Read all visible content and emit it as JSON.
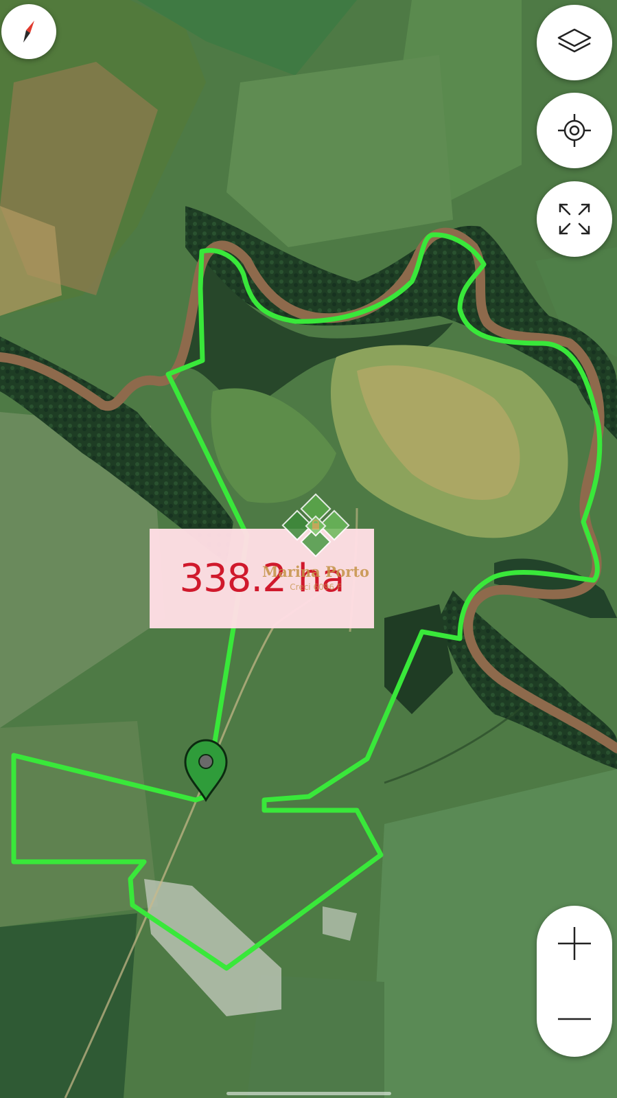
{
  "map": {
    "view": "satellite",
    "boundary_color": "#39e83a",
    "river_color": "#8e6a4c",
    "area_label": "338.2 ha",
    "area_label_color": "#d0192c"
  },
  "watermark": {
    "name": "Marina Porto",
    "subtitle": "Creci 6096 F"
  },
  "controls": {
    "compass_icon": "compass-icon",
    "layers_icon": "layers-icon",
    "locate_icon": "crosshair-icon",
    "fullscreen_icon": "expand-icon",
    "zoom_in_icon": "plus-icon",
    "zoom_out_icon": "minus-icon"
  },
  "marker": {
    "icon": "map-pin-icon",
    "color": "#2f9c3a"
  }
}
